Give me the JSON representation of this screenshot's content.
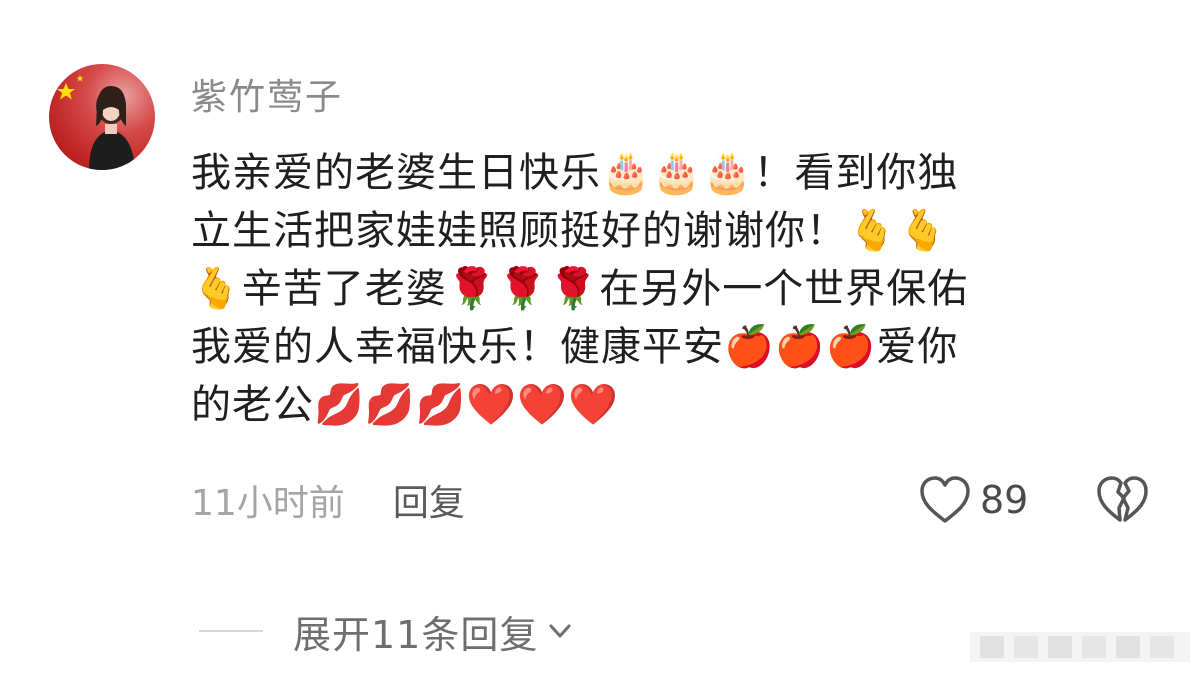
{
  "comment": {
    "author": "紫竹莺子",
    "lines": [
      "我亲爱的老婆生日快乐🎂🎂🎂！看到你独",
      "立生活把家娃娃照顾挺好的谢谢你！🫰🫰",
      "🫰辛苦了老婆🌹🌹🌹在另外一个世界保佑",
      "我爱的人幸福快乐！健康平安🍎🍎🍎爱你",
      "的老公💋💋💋❤️❤️❤️"
    ],
    "time": "11小时前",
    "reply_label": "回复",
    "like_count": "89",
    "expand_label": "展开11条回复"
  },
  "icons": {
    "avatar": "avatar-with-flag",
    "like": "heart-outline-icon",
    "dislike": "broken-heart-icon",
    "expand": "chevron-down-icon"
  },
  "colors": {
    "author": "#8a8a8a",
    "text": "#1f1f1f",
    "meta": "#a5a5a5",
    "reply": "#5b5b5b",
    "icon": "#555555"
  }
}
